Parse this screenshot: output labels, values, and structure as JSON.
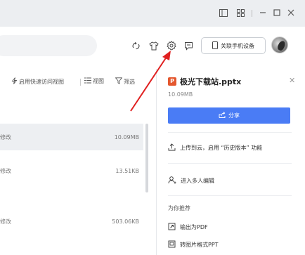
{
  "toolbar": {
    "quick_access_label": "启用快速访问视图",
    "view_label": "视图",
    "filter_label": "筛选"
  },
  "header": {
    "device_button_label": "关联手机设备"
  },
  "files": [
    {
      "left": "修改",
      "size": "10.09MB",
      "selected": true
    },
    {
      "left": "修改",
      "size": "13.51KB",
      "selected": false
    },
    {
      "left": "修改",
      "size": "503.06KB",
      "selected": false
    }
  ],
  "panel": {
    "file_name": "极光下载站.pptx",
    "file_size": "10.09MB",
    "share_label": "分享",
    "upload_label": "上传到云，启用 “历史版本” 功能",
    "collab_label": "进入多人编辑",
    "recommend_title": "为你推荐",
    "export_pdf_label": "输出为PDF",
    "convert_ppt_label": "转图片格式PPT"
  },
  "colors": {
    "accent": "#4a7cf5",
    "annotation": "#e02020",
    "ppt_icon": "#e4572e"
  }
}
